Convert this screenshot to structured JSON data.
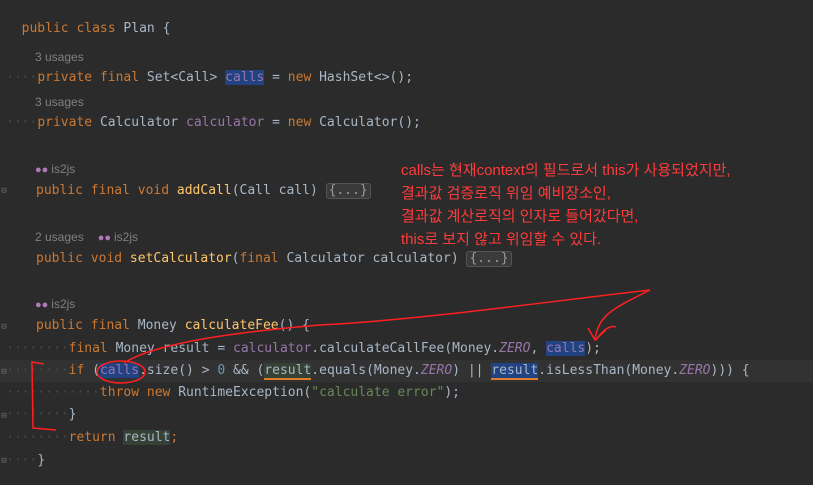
{
  "code": {
    "class_decl": {
      "kw1": "public",
      "kw2": "class",
      "name": "Plan",
      "brace": "{"
    },
    "hints": {
      "usages_calls": "3 usages",
      "usages_calculator": "3 usages",
      "author_addCall": "is2js",
      "usages_setCalculator": "2 usages",
      "author_setCalculator": "is2js",
      "author_calculateFee": "is2js"
    },
    "field_calls": {
      "mods": "private final ",
      "type": "Set<Call> ",
      "name": "calls",
      "rest1": " = ",
      "new": "new ",
      "ctor": "HashSet<>();"
    },
    "field_calculator": {
      "mods": "private ",
      "type": "Calculator ",
      "name": "calculator",
      "rest1": " = ",
      "new": "new ",
      "ctor": "Calculator();"
    },
    "method_addCall": {
      "mods": "public final void ",
      "name": "addCall",
      "params": "(Call call) ",
      "fold": "{...}"
    },
    "method_setCalculator": {
      "mods": "public void ",
      "name": "setCalculator",
      "p1": "(",
      "final": "final ",
      "p2": "Calculator calculator) ",
      "fold": "{...}"
    },
    "method_calculateFee": {
      "mods": "public final ",
      "type": "Money ",
      "name": "calculateFee",
      "rest": "() {"
    },
    "line_result": {
      "final": "final ",
      "type": "Money result = ",
      "field": "calculator",
      "call": ".calculateCallFee(Money.",
      "zero": "ZERO",
      "comma": ", ",
      "calls": "calls",
      "end": ");"
    },
    "line_if": {
      "kw": "if ",
      "open": "(",
      "calls": "calls",
      "size": ".size() > ",
      "zero_num": "0",
      "and": " && (",
      "result": "result",
      "eq": ".equals(Money.",
      "zero": "ZERO",
      "mid": ") || ",
      "result2": "result",
      "less": ".isLessThan(Money.",
      "zero2": "ZERO",
      "end": "))) {"
    },
    "line_throw": {
      "throw": "throw ",
      "new": "new ",
      "exc": "RuntimeException(",
      "msg": "\"calculate error\"",
      "end": ");"
    },
    "close_if": "}",
    "line_return": {
      "kw": "return ",
      "val": "result",
      "end": ";"
    },
    "close_method": "}"
  },
  "annotation": {
    "line1": "calls는 현재context의 필드로서 this가 사용되었지만,",
    "line2": "결과값 검증로직 위임 예비장소인,",
    "line3": "결과값 계산로직의 인자로 들어갔다면,",
    "line4": "this로 보지 않고 위임할 수 있다."
  },
  "colors": {
    "background": "#2b2b2b",
    "keyword": "#cc7832",
    "field": "#9876aa",
    "method": "#ffc66d",
    "annotation": "#ff3b3b"
  }
}
